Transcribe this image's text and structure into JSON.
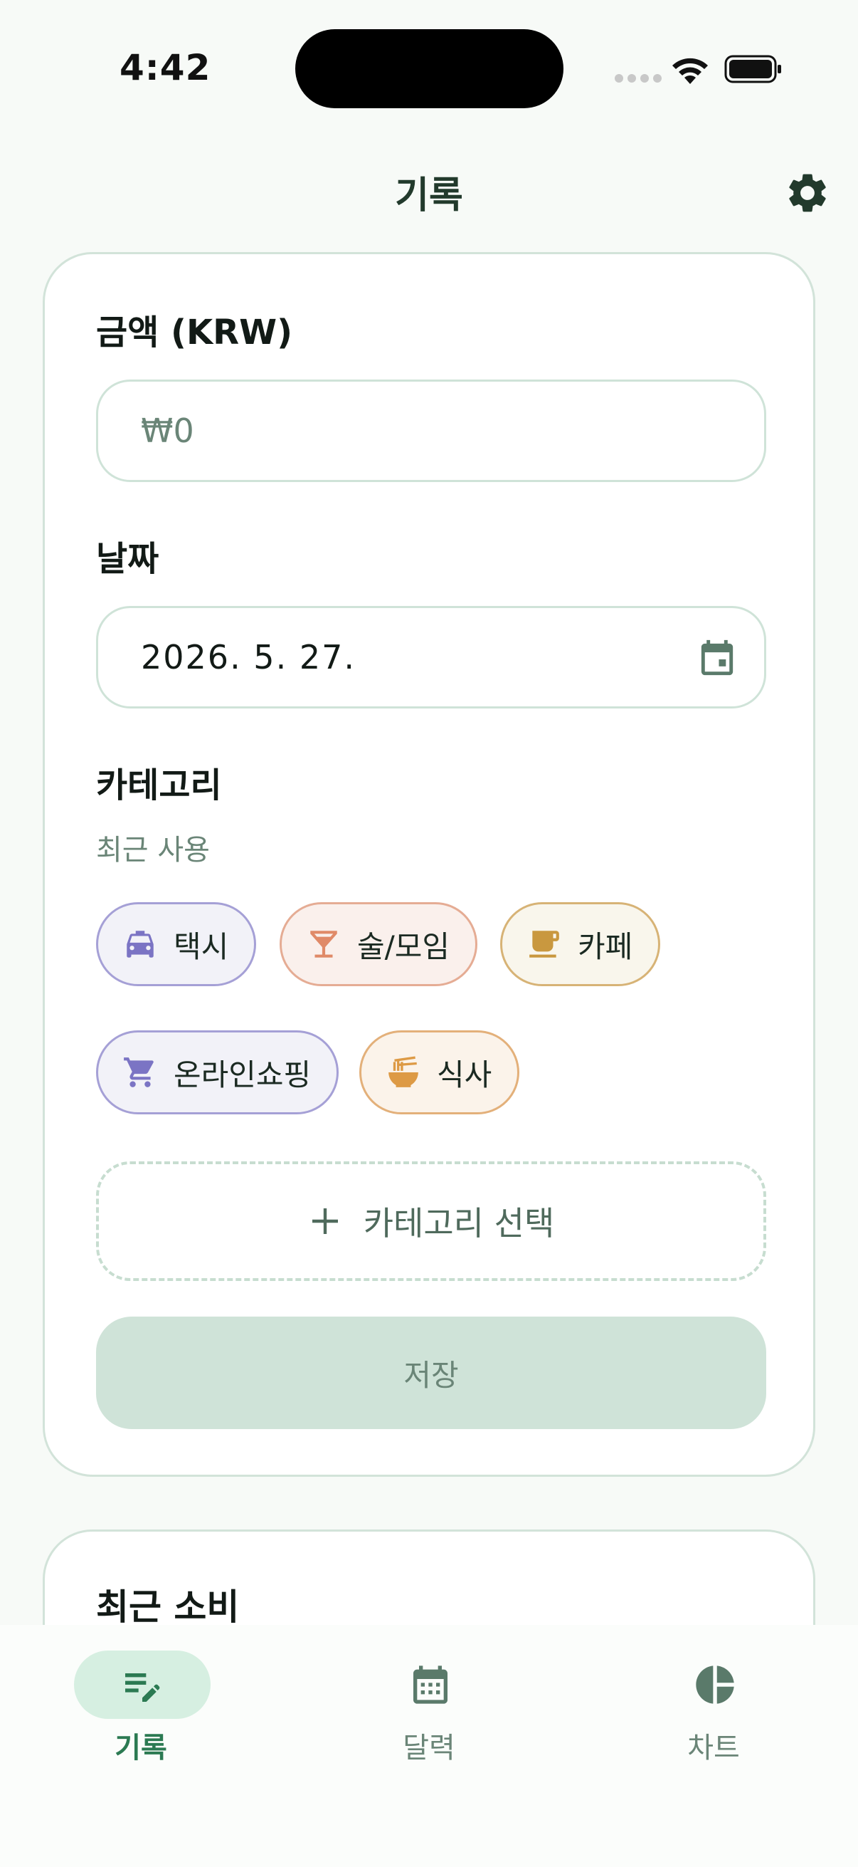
{
  "status_bar": {
    "time": "4:42"
  },
  "header": {
    "title": "기록"
  },
  "form": {
    "amount_label": "금액 (KRW)",
    "amount_placeholder": "₩0",
    "date_label": "날짜",
    "date_value": "2026. 5. 27.",
    "category_label": "카테고리",
    "recent_used_label": "최근 사용",
    "recent_categories": [
      {
        "label": "택시",
        "icon": "taxi-icon",
        "color": "#7b74c4"
      },
      {
        "label": "술/모임",
        "icon": "cocktail-icon",
        "color": "#e08a68"
      },
      {
        "label": "카페",
        "icon": "coffee-icon",
        "color": "#c9983f"
      },
      {
        "label": "온라인쇼핑",
        "icon": "cart-icon",
        "color": "#7b74c4"
      },
      {
        "label": "식사",
        "icon": "noodle-bowl-icon",
        "color": "#dd9a45"
      }
    ],
    "select_category_label": "카테고리 선택",
    "save_label": "저장"
  },
  "recent": {
    "title": "최근 소비"
  },
  "nav": {
    "items": [
      {
        "label": "기록",
        "icon": "edit-list-icon",
        "active": true
      },
      {
        "label": "달력",
        "icon": "calendar-icon",
        "active": false
      },
      {
        "label": "차트",
        "icon": "pie-chart-icon",
        "active": false
      }
    ]
  },
  "colors": {
    "accent": "#2b7a52",
    "border": "#d2e3d9",
    "muted": "#6a8577"
  }
}
